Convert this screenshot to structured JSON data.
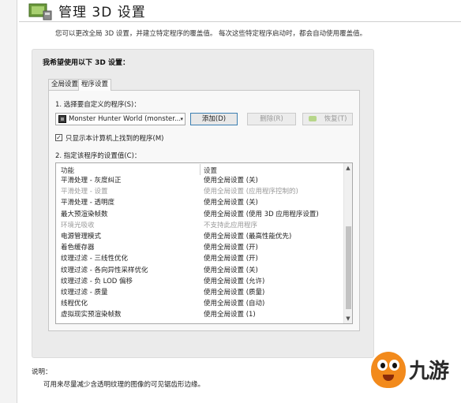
{
  "header": {
    "title": "管理 3D 设置",
    "subtitle": "您可以更改全局 3D 设置，并建立特定程序的覆盖值。 每次这些特定程序启动时，都会自动使用覆盖值。"
  },
  "panel": {
    "heading": "我希望使用以下 3D 设置：",
    "tabs": [
      {
        "label": "全局设置",
        "active": false
      },
      {
        "label": "程序设置",
        "active": true
      }
    ],
    "select_program_label": "1. 选择要自定义的程序(S)：",
    "selected_program": "Monster Hunter World (monster...",
    "buttons": {
      "add": "添加(D)",
      "delete": "删除(R)",
      "restore": "恢复(T)"
    },
    "checkbox": {
      "label": "只显示本计算机上找到的程序(M)",
      "checked": true,
      "check_glyph": "✓"
    },
    "settings_label": "2. 指定该程序的设置值(C)：",
    "list": {
      "columns": {
        "feature": "功能",
        "setting": "设置"
      },
      "rows": [
        {
          "feature": "平滑处理 - 灰度纠正",
          "setting": "使用全局设置 (关)",
          "muted": false
        },
        {
          "feature": "平滑处理 - 设置",
          "setting": "使用全局设置 (应用程序控制的)",
          "muted": true
        },
        {
          "feature": "平滑处理 - 透明度",
          "setting": "使用全局设置 (关)",
          "muted": false
        },
        {
          "feature": "最大预渲染帧数",
          "setting": "使用全局设置 (使用 3D 应用程序设置)",
          "muted": false
        },
        {
          "feature": "环境光吸收",
          "setting": "不支持此应用程序",
          "muted": true
        },
        {
          "feature": "电源管理模式",
          "setting": "使用全局设置 (最高性能优先)",
          "muted": false
        },
        {
          "feature": "着色缓存器",
          "setting": "使用全局设置 (开)",
          "muted": false
        },
        {
          "feature": "纹理过滤 - 三线性优化",
          "setting": "使用全局设置 (开)",
          "muted": false
        },
        {
          "feature": "纹理过滤 - 各向异性采样优化",
          "setting": "使用全局设置 (关)",
          "muted": false
        },
        {
          "feature": "纹理过滤 - 负 LOD 偏移",
          "setting": "使用全局设置 (允许)",
          "muted": false
        },
        {
          "feature": "纹理过滤 - 质量",
          "setting": "使用全局设置 (质量)",
          "muted": false
        },
        {
          "feature": "线程优化",
          "setting": "使用全局设置 (自动)",
          "muted": false
        },
        {
          "feature": "虚拟现实预渲染帧数",
          "setting": "使用全局设置 (1)",
          "muted": false
        }
      ]
    }
  },
  "description": {
    "title": "说明：",
    "text": "可用来尽量减少含透明纹理的图像的可见锯齿形边缘。"
  },
  "watermark": {
    "text": "九游"
  },
  "icons": {
    "dropdown": "▾",
    "scroll_up": "▲",
    "scroll_down": "▼"
  }
}
